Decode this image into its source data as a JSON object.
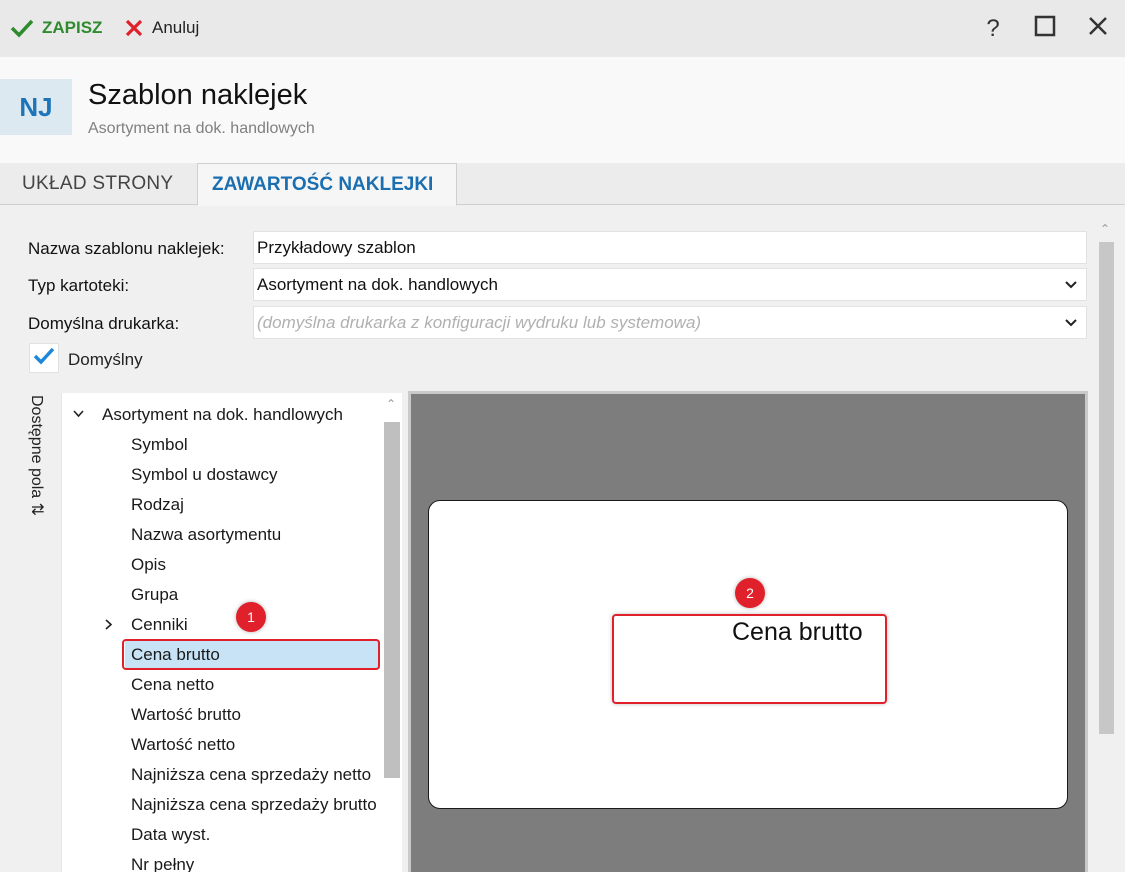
{
  "toolbar": {
    "save_label": "ZAPISZ",
    "cancel_label": "Anuluj",
    "help_label": "?",
    "accent_save": "#2e8b2e",
    "accent_cancel": "#e0202a"
  },
  "header": {
    "badge": "NJ",
    "title": "Szablon naklejek",
    "subtitle": "Asortyment na dok. handlowych"
  },
  "tabs": [
    {
      "label": "UKŁAD STRONY",
      "active": false
    },
    {
      "label": "ZAWARTOŚĆ NAKLEJKI",
      "active": true
    }
  ],
  "form": {
    "name_label": "Nazwa szablonu naklejek:",
    "name_value": "Przykładowy szablon",
    "type_label": "Typ kartoteki:",
    "type_value": "Asortyment na dok. handlowych",
    "printer_label": "Domyślna drukarka:",
    "printer_placeholder": "(domyślna drukarka z konfiguracji wydruku lub systemowa)",
    "default_label": "Domyślny",
    "default_checked": true
  },
  "side_panel": {
    "label": "Dostępne pola ⇅"
  },
  "tree": {
    "root": "Asortyment na dok. handlowych",
    "items": [
      "Symbol",
      "Symbol u dostawcy",
      "Rodzaj",
      "Nazwa asortymentu",
      "Opis",
      "Grupa",
      "Cenniki",
      "Cena brutto",
      "Cena netto",
      "Wartość brutto",
      "Wartość netto",
      "Najniższa cena sprzedaży netto",
      "Najniższa cena sprzedaży brutto",
      "Data wyst.",
      "Nr pełny"
    ],
    "selected": "Cena brutto",
    "selected_color": "#c7e3f5"
  },
  "preview": {
    "field_text": "Cena brutto"
  },
  "markers": {
    "one": "1",
    "two": "2",
    "color": "#e0202a"
  }
}
